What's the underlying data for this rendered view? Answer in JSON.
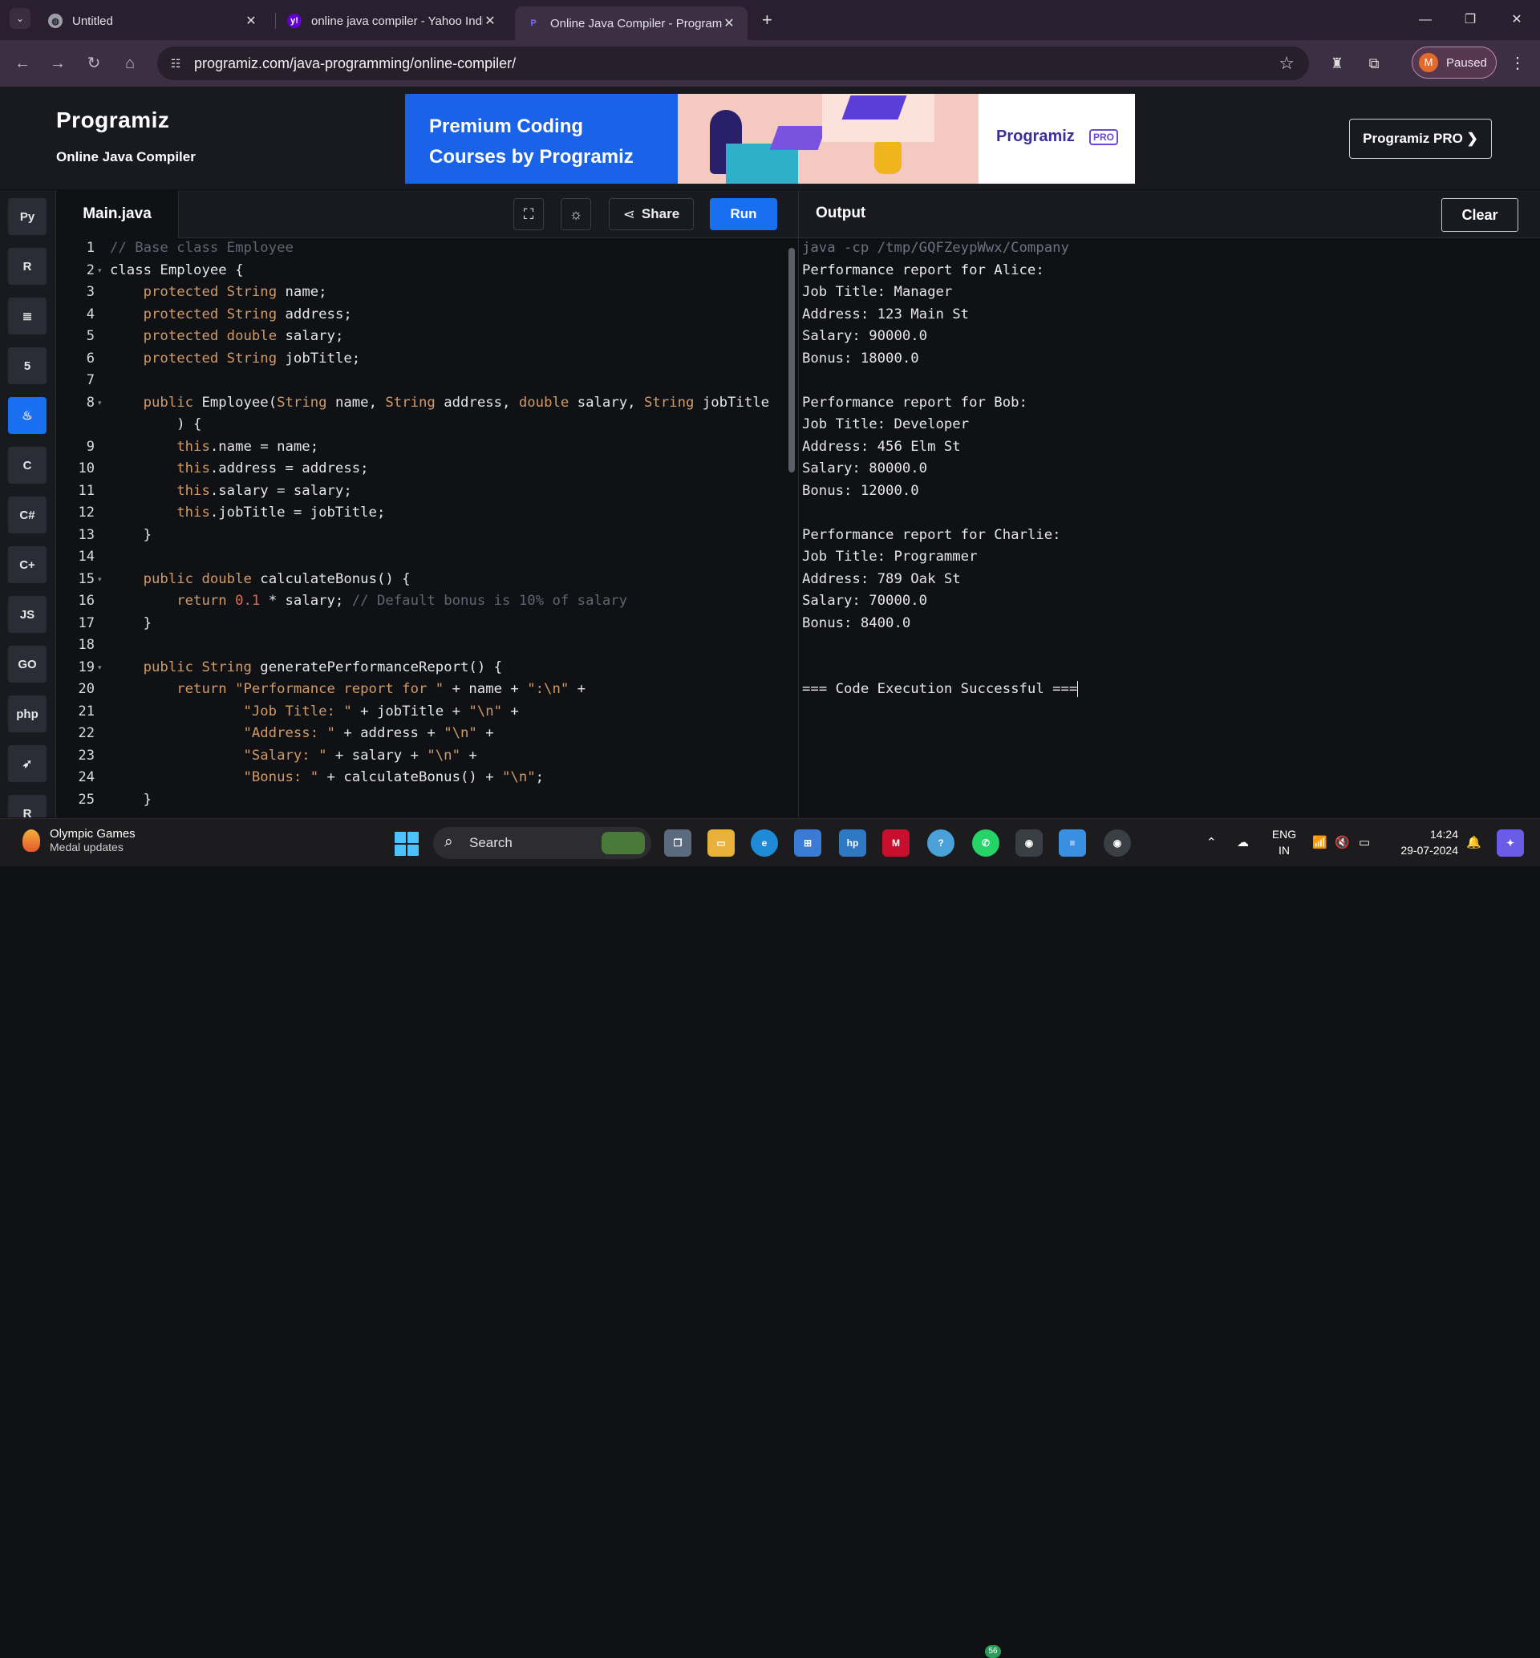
{
  "browser": {
    "tabs": [
      {
        "title": "Untitled",
        "icon": "globe-icon"
      },
      {
        "title": "online java compiler - Yahoo India Search Results",
        "icon": "yahoo-icon"
      },
      {
        "title": "Online Java Compiler - Programiz",
        "icon": "programiz-icon"
      }
    ],
    "url": "programiz.com/java-programming/online-compiler/",
    "profile_initial": "M",
    "profile_label": "Paused"
  },
  "header": {
    "logo": "Programiz",
    "subtitle": "Online Java Compiler",
    "banner_line1": "Premium Coding",
    "banner_line2": "Courses by Programiz",
    "banner_brand": "Programiz",
    "banner_pro": "PRO",
    "pro_button": "Programiz PRO ❯"
  },
  "rail": {
    "languages": [
      {
        "name": "python",
        "glyph": "Py"
      },
      {
        "name": "r",
        "glyph": "R"
      },
      {
        "name": "sql",
        "glyph": "≣"
      },
      {
        "name": "html",
        "glyph": "5"
      },
      {
        "name": "java",
        "glyph": "♨"
      },
      {
        "name": "c",
        "glyph": "C"
      },
      {
        "name": "csharp",
        "glyph": "C#"
      },
      {
        "name": "cpp",
        "glyph": "C+"
      },
      {
        "name": "javascript",
        "glyph": "JS"
      },
      {
        "name": "go",
        "glyph": "GO"
      },
      {
        "name": "php",
        "glyph": "php"
      },
      {
        "name": "swift",
        "glyph": "➶"
      },
      {
        "name": "rust",
        "glyph": "R"
      }
    ]
  },
  "editor": {
    "filename": "Main.java",
    "share_label": "Share",
    "run_label": "Run",
    "line_numbers": [
      "1",
      "2",
      "3",
      "4",
      "5",
      "6",
      "7",
      "8",
      "",
      "9",
      "10",
      "11",
      "12",
      "13",
      "14",
      "15",
      "16",
      "17",
      "18",
      "19",
      "20",
      "21",
      "22",
      "23",
      "24",
      "25"
    ],
    "lines": [
      "// Base class Employee",
      "class Employee {",
      "    protected String name;",
      "    protected String address;",
      "    protected double salary;",
      "    protected String jobTitle;",
      "",
      "    public Employee(String name, String address, double salary, String jobTitle",
      "        ) {",
      "        this.name = name;",
      "        this.address = address;",
      "        this.salary = salary;",
      "        this.jobTitle = jobTitle;",
      "    }",
      "",
      "    public double calculateBonus() {",
      "        return 0.1 * salary; // Default bonus is 10% of salary",
      "    }",
      "",
      "    public String generatePerformanceReport() {",
      "        return \"Performance report for \" + name + \":\\n\" +",
      "                \"Job Title: \" + jobTitle + \"\\n\" +",
      "                \"Address: \" + address + \"\\n\" +",
      "                \"Salary: \" + salary + \"\\n\" +",
      "                \"Bonus: \" + calculateBonus() + \"\\n\";",
      "    }"
    ]
  },
  "output": {
    "title": "Output",
    "clear_label": "Clear",
    "lines": [
      "java -cp /tmp/GQFZeypWwx/Company",
      "Performance report for Alice:",
      "Job Title: Manager",
      "Address: 123 Main St",
      "Salary: 90000.0",
      "Bonus: 18000.0",
      "",
      "Performance report for Bob:",
      "Job Title: Developer",
      "Address: 456 Elm St",
      "Salary: 80000.0",
      "Bonus: 12000.0",
      "",
      "Performance report for Charlie:",
      "Job Title: Programmer",
      "Address: 789 Oak St",
      "Salary: 70000.0",
      "Bonus: 8400.0",
      "",
      "",
      "=== Code Execution Successful ==="
    ]
  },
  "taskbar": {
    "widget_title": "Olympic Games",
    "widget_sub": "Medal updates",
    "search_placeholder": "Search",
    "whatsapp_badge": "56",
    "lang_line1": "ENG",
    "lang_line2": "IN",
    "time": "14:24",
    "date": "29-07-2024"
  },
  "colors": {
    "accent": "#1a6ff0",
    "editor_bg": "#0f1115",
    "keyword": "#d19a66",
    "comment": "#5f6673"
  }
}
